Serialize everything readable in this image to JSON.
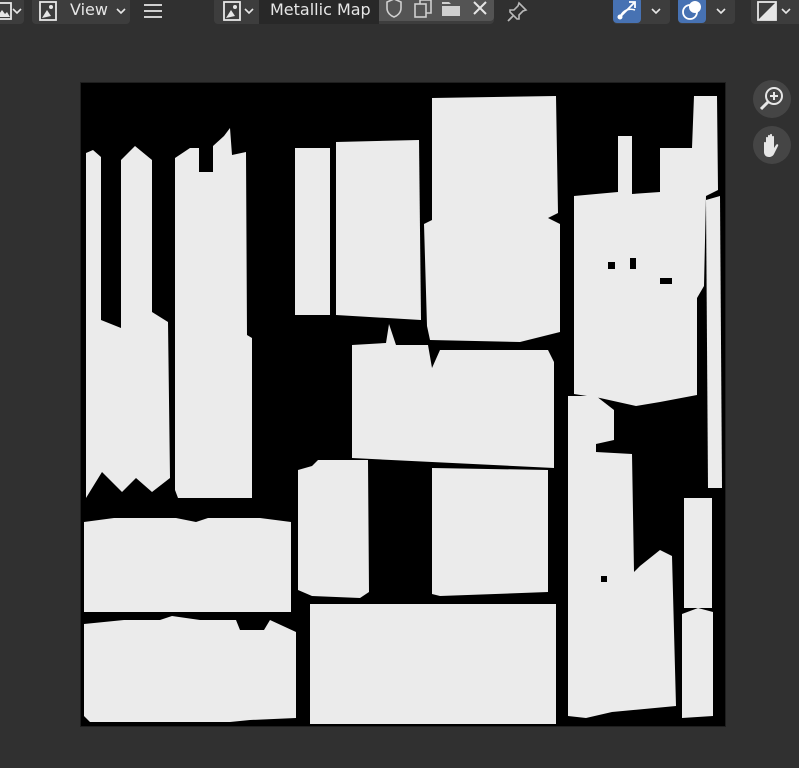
{
  "header": {
    "view_menu_label": "View",
    "image_name": "Metallic Map"
  },
  "icons": {
    "editor_type": "image-editor-icon",
    "view_menu": "image-icon",
    "hamburger": "menu-icon",
    "image_browse": "image-icon",
    "fake_user": "shield-icon",
    "new_image": "duplicate-icon",
    "open_image": "folder-icon",
    "unlink": "close-icon",
    "pin": "pin-icon",
    "gizmo": "gizmo-icon",
    "overlay": "overlay-icon",
    "display_channels": "display-channels-icon",
    "zoom": "zoom-in-icon",
    "pan": "hand-icon"
  },
  "colors": {
    "background": "#303030",
    "accent_blue": "#4772b3",
    "mask_white": "#ebebeb",
    "mask_black": "#000000"
  }
}
